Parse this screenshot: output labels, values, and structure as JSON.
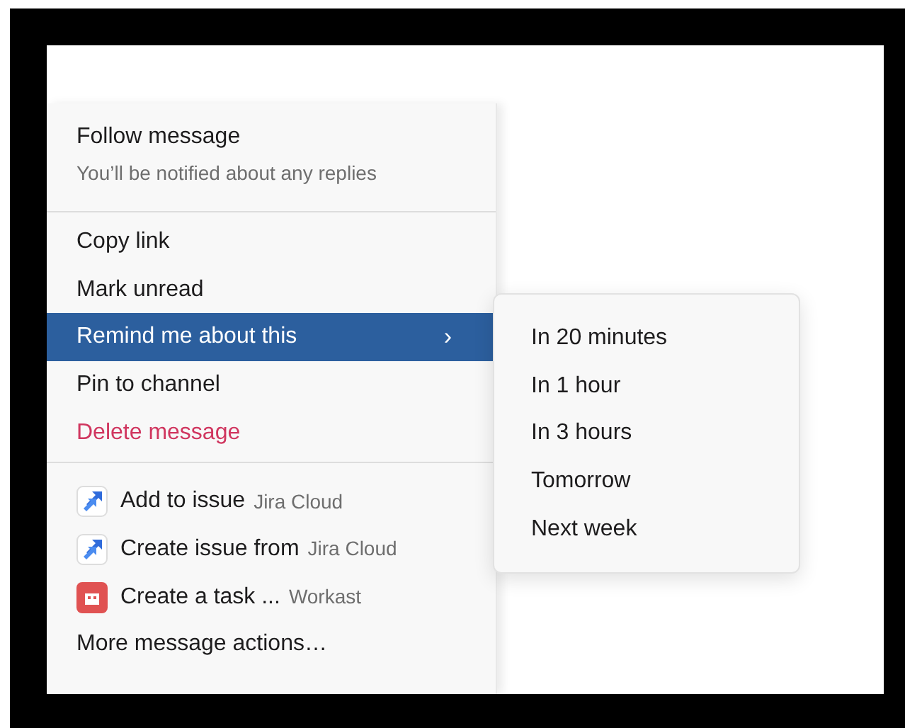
{
  "menu": {
    "sections": [
      {
        "items": [
          {
            "kind": "follow",
            "label": "Follow message",
            "description": "You’ll be notified about any replies",
            "selected": false
          }
        ]
      },
      {
        "items": [
          {
            "kind": "plain",
            "label": "Copy link",
            "selected": false
          },
          {
            "kind": "plain",
            "label": "Mark unread",
            "selected": false
          },
          {
            "kind": "submenu",
            "label": "Remind me about this",
            "chevron": "›",
            "selected": true
          },
          {
            "kind": "plain",
            "label": "Pin to channel",
            "selected": false
          },
          {
            "kind": "danger",
            "label": "Delete message",
            "selected": false
          }
        ]
      },
      {
        "items": [
          {
            "kind": "app",
            "icon": {
              "kind": "jira"
            },
            "label": "Add to issue",
            "app": "Jira Cloud",
            "selected": false
          },
          {
            "kind": "app",
            "icon": {
              "kind": "jira"
            },
            "label": "Create issue from",
            "app": "Jira Cloud",
            "selected": false
          },
          {
            "kind": "app",
            "icon": {
              "kind": "workast"
            },
            "label": "Create a task ...",
            "app": "Workast",
            "selected": false
          },
          {
            "kind": "plain",
            "label": "More message actions…",
            "selected": false
          }
        ]
      }
    ]
  },
  "submenu": {
    "items": [
      {
        "label": "In 20 minutes"
      },
      {
        "label": "In 1 hour"
      },
      {
        "label": "In 3 hours"
      },
      {
        "label": "Tomorrow"
      },
      {
        "label": "Next week"
      }
    ]
  }
}
